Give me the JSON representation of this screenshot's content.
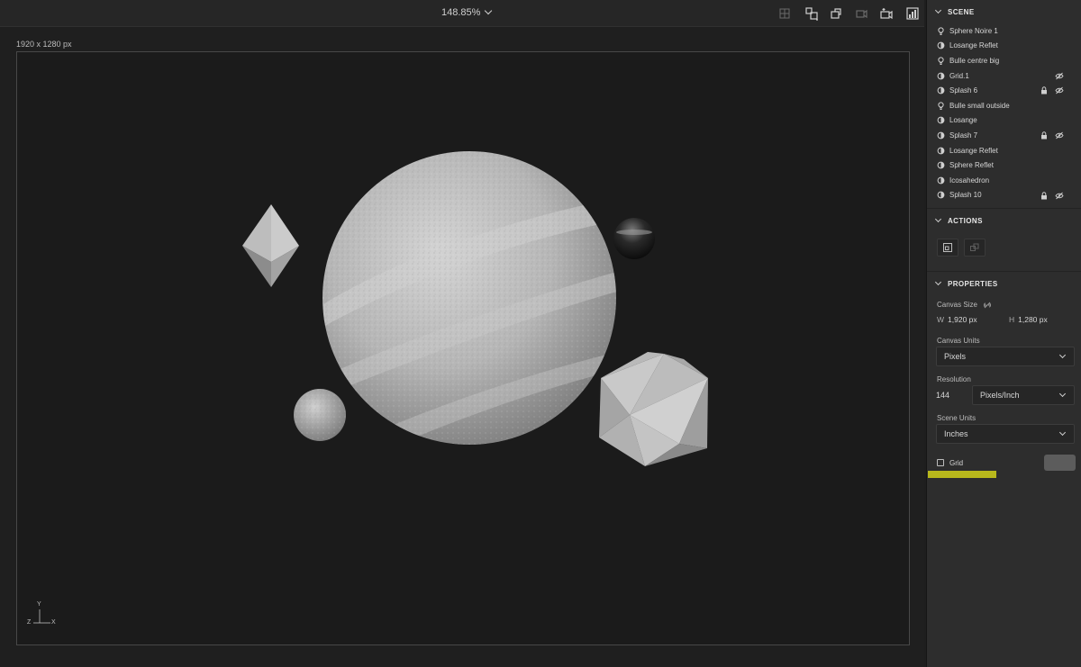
{
  "toolbar": {
    "zoom": "148.85%",
    "tools": [
      {
        "icon": "grid-view-icon"
      },
      {
        "icon": "align-objects-icon"
      },
      {
        "icon": "rotate-object-icon"
      },
      {
        "icon": "move-camera-icon"
      },
      {
        "icon": "add-camera-icon"
      },
      {
        "icon": "render-preview-icon"
      }
    ]
  },
  "viewport": {
    "canvas_size_label": "1920 x 1280 px",
    "axis": {
      "y": "Y",
      "x": "X",
      "z": "Z"
    }
  },
  "scene": {
    "title": "SCENE",
    "layers": [
      {
        "name": "Sphere Noire 1",
        "icon": "light-bulb-icon",
        "locked": false,
        "hidden": false
      },
      {
        "name": "Losange Reflet",
        "icon": "model-icon",
        "locked": false,
        "hidden": false
      },
      {
        "name": "Bulle centre big",
        "icon": "light-bulb-icon",
        "locked": false,
        "hidden": false
      },
      {
        "name": "Grid.1",
        "icon": "model-icon",
        "locked": false,
        "hidden": true
      },
      {
        "name": "Splash 6",
        "icon": "model-icon",
        "locked": true,
        "hidden": true
      },
      {
        "name": "Bulle small outside",
        "icon": "light-bulb-icon",
        "locked": false,
        "hidden": false
      },
      {
        "name": "Losange",
        "icon": "model-icon",
        "locked": false,
        "hidden": false
      },
      {
        "name": "Splash 7",
        "icon": "model-icon",
        "locked": true,
        "hidden": true
      },
      {
        "name": "Losange Reflet",
        "icon": "model-icon",
        "locked": false,
        "hidden": false
      },
      {
        "name": "Sphere Reflet",
        "icon": "model-icon",
        "locked": false,
        "hidden": false
      },
      {
        "name": "Icosahedron",
        "icon": "model-icon",
        "locked": false,
        "hidden": false
      },
      {
        "name": "Splash 10",
        "icon": "model-icon",
        "locked": true,
        "hidden": true
      }
    ]
  },
  "actions": {
    "title": "ACTIONS",
    "buttons": [
      {
        "icon": "resize-canvas-icon"
      },
      {
        "icon": "group-objects-icon"
      }
    ]
  },
  "properties": {
    "title": "PROPERTIES",
    "canvas_size_label": "Canvas Size",
    "w_label": "W",
    "w_value": "1,920 px",
    "h_label": "H",
    "h_value": "1,280 px",
    "canvas_units_label": "Canvas Units",
    "canvas_units_value": "Pixels",
    "resolution_label": "Resolution",
    "resolution_value": "144",
    "resolution_unit": "Pixels/Inch",
    "scene_units_label": "Scene Units",
    "scene_units_value": "Inches",
    "grid_label": "Grid",
    "grid_checked": false,
    "grid_color": "#5c5c5c",
    "highlight_color": "#b8b81c"
  }
}
